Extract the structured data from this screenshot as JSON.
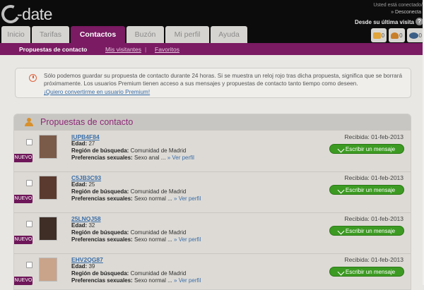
{
  "header": {
    "logo_text": "-date",
    "connected_text": "Usted está conectado/",
    "disconnect_text": "» Desconecta",
    "last_visit_text": "Desde su última visita",
    "help_glyph": "?"
  },
  "tabs": [
    {
      "label": "Inicio",
      "active": false
    },
    {
      "label": "Tarifas",
      "active": false
    },
    {
      "label": "Contactos",
      "active": true
    },
    {
      "label": "Buzón",
      "active": false
    },
    {
      "label": "Mi perfil",
      "active": false
    },
    {
      "label": "Ayuda",
      "active": false
    }
  ],
  "icons": {
    "messages_count": "0",
    "contacts_count": "0",
    "visits_count": "0",
    "messages_icon": "envelope-icon",
    "contacts_icon": "person-icon",
    "visits_icon": "eye-icon"
  },
  "subnav": {
    "item1": "Propuestas de contacto",
    "item2": "Mis visitantes",
    "separator": "|",
    "item3": "Favoritos"
  },
  "info": {
    "text": "Sólo podemos guardar su propuesta de contacto durante 24 horas. Si se muestra un reloj rojo tras dicha propuesta, significa que se borrará próximamente. Los usuarios Premium tienen acceso a sus mensajes y propuestas de contacto tanto tiempo como deseen.",
    "link": "¡Quiero convertirme en usuario Premium!"
  },
  "panel": {
    "title": "Propuestas de contacto",
    "edad_label": "Edad:",
    "region_label": "Región de búsqueda:",
    "prefs_label": "Preferencias sexuales:",
    "ver_perfil": "» Ver perfil",
    "nuevo_label": "NUEVO",
    "message_button": "Escribir un mensaje"
  },
  "entries": [
    {
      "username": "IUPB4F84",
      "age": "27",
      "region": "Comunidad de Madrid",
      "prefs": "Sexo anal ...",
      "received": "Recibida: 01-feb-2013"
    },
    {
      "username": "C5JB3C93",
      "age": "25",
      "region": "Comunidad de Madrid",
      "prefs": "Sexo normal ...",
      "received": "Recibida: 01-feb-2013"
    },
    {
      "username": "25LNQJ58",
      "age": "32",
      "region": "Comunidad de Madrid",
      "prefs": "Sexo normal ...",
      "received": "Recibida: 01-feb-2013"
    },
    {
      "username": "EHV2QG87",
      "age": "39",
      "region": "Comunidad de Madrid",
      "prefs": "Sexo normal ...",
      "received": "Recibida: 01-feb-2013"
    }
  ],
  "colors": {
    "brand": "#7a1b63",
    "button_green": "#3c9a22",
    "link": "#3a6ea8"
  }
}
